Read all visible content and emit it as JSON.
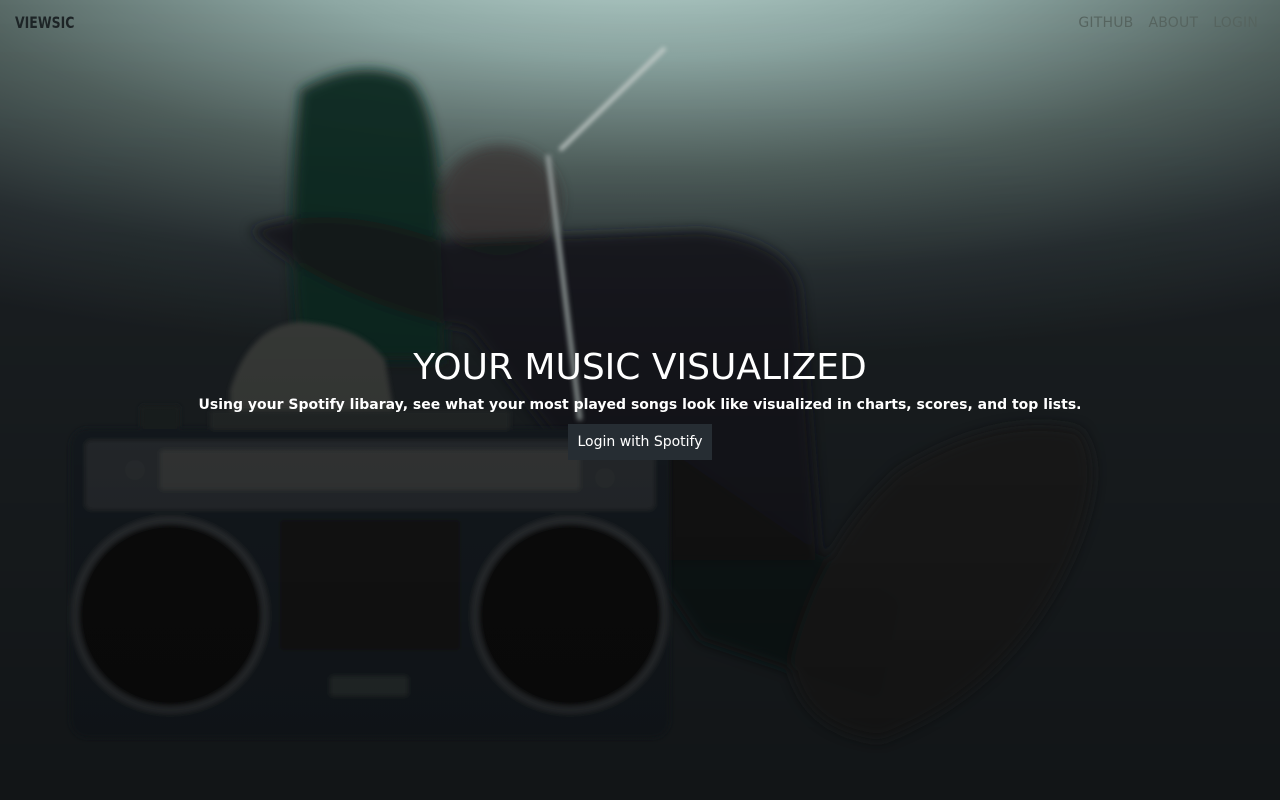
{
  "nav": {
    "brand": "VIEWSIC",
    "links": [
      {
        "label": "GITHUB"
      },
      {
        "label": "ABOUT"
      },
      {
        "label": "LOGIN"
      }
    ]
  },
  "hero": {
    "headline": "YOUR MUSIC VISUALIZED",
    "subtext": "Using your Spotify libaray, see what your most played songs look like visualized in charts, scores, and top lists.",
    "cta_label": "Login with Spotify",
    "background_photo": "person-reclining-with-feet-on-boombox"
  },
  "colors": {
    "overlay_top": "#b9d4cf",
    "overlay_bottom": "#1c2124",
    "cta_background": "#262d33",
    "text": "#ffffff"
  }
}
